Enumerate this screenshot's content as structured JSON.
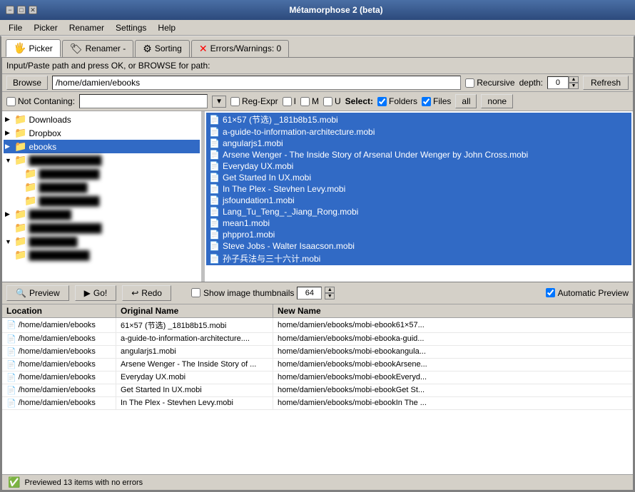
{
  "app": {
    "title": "Métamorphose 2 (beta)",
    "window_controls": [
      "−",
      "□",
      "✕"
    ]
  },
  "menu": {
    "items": [
      "File",
      "Picker",
      "Renamer",
      "Settings",
      "Help"
    ]
  },
  "tabs": [
    {
      "id": "picker",
      "label": "Picker",
      "icon": "🖐",
      "active": true
    },
    {
      "id": "renamer",
      "label": "Renamer -",
      "icon": "🏷",
      "active": false
    },
    {
      "id": "sorting",
      "label": "Sorting",
      "icon": "⚙",
      "active": false
    },
    {
      "id": "errors",
      "label": "Errors/Warnings: 0",
      "icon": "✕",
      "active": false
    }
  ],
  "path_bar": {
    "label": "Input/Paste path and press OK, or BROWSE for path:",
    "browse_label": "Browse",
    "path_value": "/home/damien/ebooks",
    "recursive_label": "Recursive",
    "depth_label": "depth:",
    "depth_value": "0",
    "refresh_label": "Refresh"
  },
  "filter_bar": {
    "not_containing_label": "Not Contaning:",
    "filter_value": "",
    "reg_expr_label": "Reg-Expr",
    "i_label": "I",
    "m_label": "M",
    "u_label": "U",
    "select_label": "Select:",
    "folders_label": "Folders",
    "files_label": "Files",
    "all_label": "all",
    "none_label": "none"
  },
  "folder_tree": {
    "items": [
      {
        "id": "downloads",
        "label": "Downloads",
        "level": 1,
        "expanded": false
      },
      {
        "id": "dropbox",
        "label": "Dropbox",
        "level": 1,
        "expanded": false
      },
      {
        "id": "ebooks",
        "label": "ebooks",
        "level": 1,
        "expanded": false,
        "selected": true
      },
      {
        "id": "f1",
        "label": "████████",
        "level": 1,
        "blurred": true,
        "expanded": true
      },
      {
        "id": "f2",
        "label": "████████████",
        "level": 2,
        "blurred": true
      },
      {
        "id": "f3",
        "label": "████████",
        "level": 2,
        "blurred": true
      },
      {
        "id": "f4",
        "label": "████████████",
        "level": 2,
        "blurred": true
      },
      {
        "id": "f5",
        "label": "████████",
        "level": 1,
        "blurred": true
      },
      {
        "id": "f6",
        "label": "████████████",
        "level": 1,
        "blurred": true
      },
      {
        "id": "f7",
        "label": "████████",
        "level": 1,
        "blurred": true,
        "expanded": true
      },
      {
        "id": "f8",
        "label": "████████████",
        "level": 1,
        "blurred": true
      }
    ]
  },
  "file_list": {
    "items": [
      {
        "name": "61×57 (节选) _181b8b15.mobi",
        "selected": true
      },
      {
        "name": "a-guide-to-information-architecture.mobi",
        "selected": true
      },
      {
        "name": "angularjs1.mobi",
        "selected": true
      },
      {
        "name": "Arsene Wenger - The Inside Story of Arsenal Under Wenger by John Cross.mobi",
        "selected": true
      },
      {
        "name": "Everyday UX.mobi",
        "selected": true
      },
      {
        "name": "Get Started In UX.mobi",
        "selected": true
      },
      {
        "name": "In The Plex - Stevhen Levy.mobi",
        "selected": true
      },
      {
        "name": "jsfoundation1.mobi",
        "selected": true
      },
      {
        "name": "Lang_Tu_Teng_-_Jiang_Rong.mobi",
        "selected": true
      },
      {
        "name": "mean1.mobi",
        "selected": true
      },
      {
        "name": "phppro1.mobi",
        "selected": true
      },
      {
        "name": "Steve Jobs - Walter Isaacson.mobi",
        "selected": true
      },
      {
        "name": "孙子兵法与三十六计.mobi",
        "selected": true
      }
    ]
  },
  "bottom_toolbar": {
    "preview_label": "Preview",
    "go_label": "Go!",
    "redo_label": "Redo",
    "thumbnail_label": "Show image thumbnails",
    "thumbnail_size": "64",
    "auto_preview_label": "Automatic Preview"
  },
  "results_table": {
    "columns": [
      "Location",
      "Original Name",
      "New Name"
    ],
    "rows": [
      {
        "location": "/home/damien/ebooks",
        "original": "61×57 (节选) _181b8b15.mobi",
        "new_name": "home/damien/ebooks/mobi-ebook61×57..."
      },
      {
        "location": "/home/damien/ebooks",
        "original": "a-guide-to-information-architecture....",
        "new_name": "home/damien/ebooks/mobi-ebooka-guid..."
      },
      {
        "location": "/home/damien/ebooks",
        "original": "angularjs1.mobi",
        "new_name": "home/damien/ebooks/mobi-ebookangula..."
      },
      {
        "location": "/home/damien/ebooks",
        "original": "Arsene Wenger - The Inside Story of ...",
        "new_name": "home/damien/ebooks/mobi-ebookArsene..."
      },
      {
        "location": "/home/damien/ebooks",
        "original": "Everyday UX.mobi",
        "new_name": "home/damien/ebooks/mobi-ebookEveryd..."
      },
      {
        "location": "/home/damien/ebooks",
        "original": "Get Started In UX.mobi",
        "new_name": "home/damien/ebooks/mobi-ebookGet St..."
      },
      {
        "location": "/home/damien/ebooks",
        "original": "In The Plex - Stevhen Levy.mobi",
        "new_name": "home/damien/ebooks/mobi-ebookIn The ..."
      }
    ]
  },
  "status_bar": {
    "message": "Previewed 13 items with no errors"
  }
}
